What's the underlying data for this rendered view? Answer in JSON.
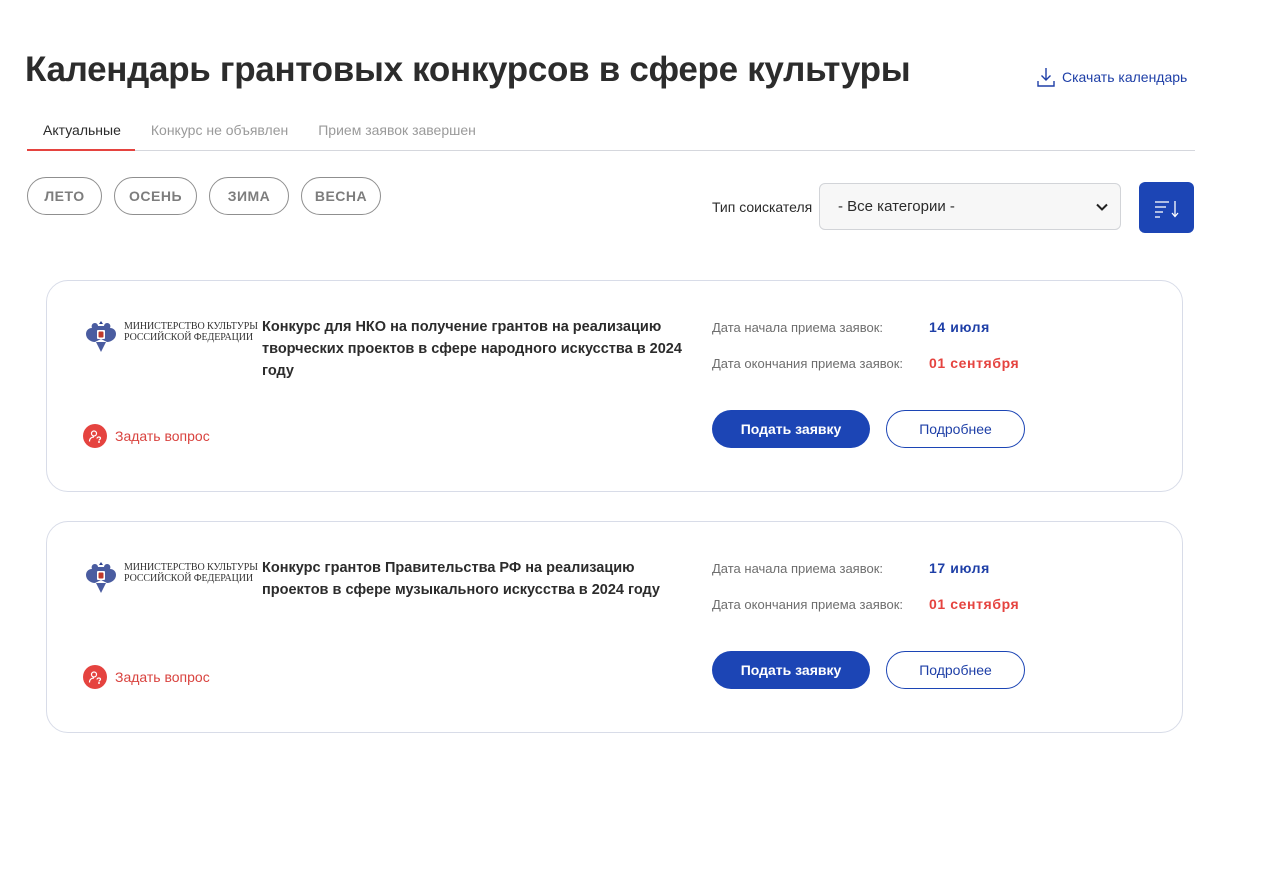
{
  "page": {
    "title": "Календарь грантовых конкурсов в сфере культуры",
    "download_label": "Скачать календарь"
  },
  "tabs": [
    {
      "label": "Актуальные",
      "active": true
    },
    {
      "label": "Конкурс не объявлен",
      "active": false
    },
    {
      "label": "Прием заявок завершен",
      "active": false
    }
  ],
  "seasons": [
    "ЛЕТО",
    "ОСЕНЬ",
    "ЗИМА",
    "ВЕСНА"
  ],
  "filter": {
    "label": "Тип соискателя",
    "selected": "- Все категории -"
  },
  "colors": {
    "accent_blue": "#1c45b5",
    "accent_red": "#e5433f"
  },
  "cards": [
    {
      "org_line1": "МИНИСТЕРСТВО КУЛЬТУРЫ",
      "org_line2": "РОССИЙСКОЙ ФЕДЕРАЦИИ",
      "title": "Конкурс для НКО на получение грантов на реализацию творческих проектов в сфере народного искусства в 2024 году",
      "start_label": "Дата начала приема заявок:",
      "start_value": "14 июля",
      "end_label": "Дата окончания приема заявок:",
      "end_value": "01 сентября",
      "apply_label": "Подать заявку",
      "details_label": "Подробнее",
      "ask_label": "Задать вопрос"
    },
    {
      "org_line1": "МИНИСТЕРСТВО КУЛЬТУРЫ",
      "org_line2": "РОССИЙСКОЙ ФЕДЕРАЦИИ",
      "title": "Конкурс грантов Правительства РФ на реализацию проектов в сфере музыкального искусства в 2024 году",
      "start_label": "Дата начала приема заявок:",
      "start_value": "17 июля",
      "end_label": "Дата окончания приема заявок:",
      "end_value": "01 сентября",
      "apply_label": "Подать заявку",
      "details_label": "Подробнее",
      "ask_label": "Задать вопрос"
    }
  ]
}
